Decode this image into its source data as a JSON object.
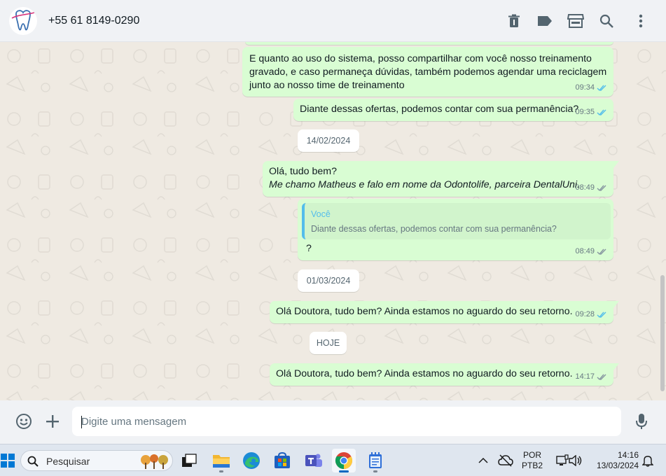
{
  "header": {
    "contact": "+55 61 8149-0290",
    "icons": [
      "trash-icon",
      "label-icon",
      "store-icon",
      "search-icon",
      "more-vertical-icon"
    ]
  },
  "messages": [
    {
      "text_lines": [
        "E quanto ao uso do sistema, posso compartilhar com você nosso treinamento",
        "gravado, e caso permaneça dúvidas, também podemos agendar uma reciclagem",
        "junto ao nosso time de treinamento"
      ],
      "time": "09:34",
      "status": "read"
    },
    {
      "text": "Diante dessas ofertas, podemos contar com sua permanência?",
      "time": "09:35",
      "status": "read"
    },
    {
      "type": "date",
      "text": "14/02/2024"
    },
    {
      "line1": "Olá, tudo bem?",
      "line2": "Me chamo Matheus e falo em nome da Odontolife, parceira DentalUni.",
      "time": "08:49",
      "status": "read"
    },
    {
      "quote_author": "Você",
      "quote_text": "Diante dessas ofertas, podemos contar com sua permanência?",
      "text": "?",
      "time": "08:49",
      "status": "read"
    },
    {
      "type": "date",
      "text": "01/03/2024"
    },
    {
      "text": "Olá Doutora, tudo bem? Ainda estamos no aguardo do seu retorno.",
      "time": "09:28",
      "status": "read"
    },
    {
      "type": "date",
      "text": "HOJE"
    },
    {
      "text": "Olá Doutora, tudo bem? Ainda estamos no aguardo do seu retorno.",
      "time": "14:17",
      "status": "read"
    }
  ],
  "composer": {
    "placeholder": "Digite uma mensagem",
    "icons": [
      "emoji-icon",
      "plus-icon",
      "microphone-icon"
    ]
  },
  "taskbar": {
    "search_label": "Pesquisar",
    "apps": [
      "windows-start-icon",
      "task-view-icon",
      "file-explorer-icon",
      "edge-icon",
      "store-icon",
      "teams-icon",
      "chrome-icon",
      "notepad-icon"
    ],
    "active_app": "chrome-icon",
    "language": "POR",
    "layout": "PTB2",
    "time": "14:16",
    "date": "13/03/2024"
  },
  "colors": {
    "outgoing_bubble": "#d9fdd3",
    "chat_background": "#efeae2",
    "read_ticks": "#53bdeb",
    "quote_bar": "#53bdeb"
  }
}
